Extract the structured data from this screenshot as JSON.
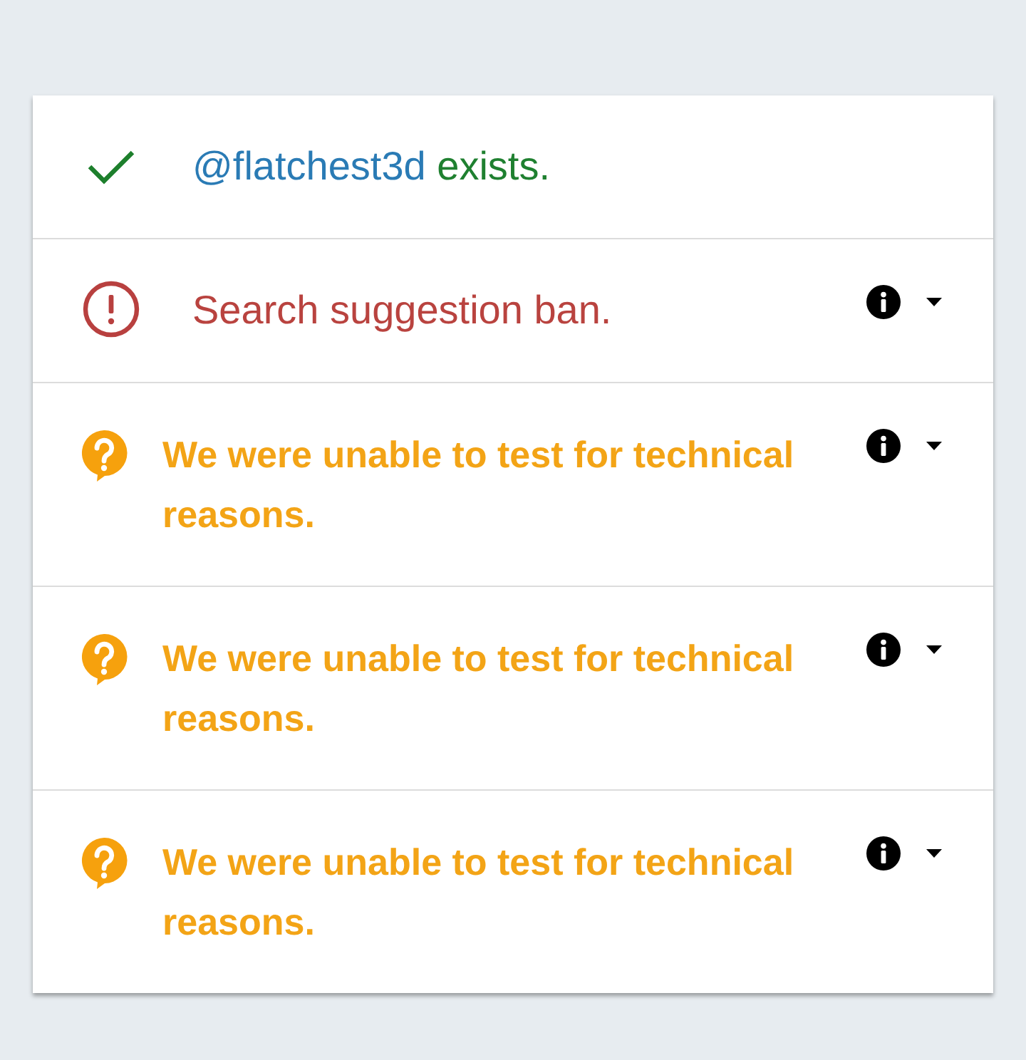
{
  "results": [
    {
      "kind": "success",
      "handle": "@flatchest3d",
      "message": "exists."
    },
    {
      "kind": "ban",
      "message": "Search suggestion ban.",
      "expanded": false
    },
    {
      "kind": "unknown",
      "message": "We were unable to test for technical reasons.",
      "expanded": false
    },
    {
      "kind": "unknown",
      "message": "We were unable to test for technical reasons.",
      "expanded": false
    },
    {
      "kind": "unknown",
      "message": "We were unable to test for technical reasons.",
      "expanded": false
    }
  ]
}
